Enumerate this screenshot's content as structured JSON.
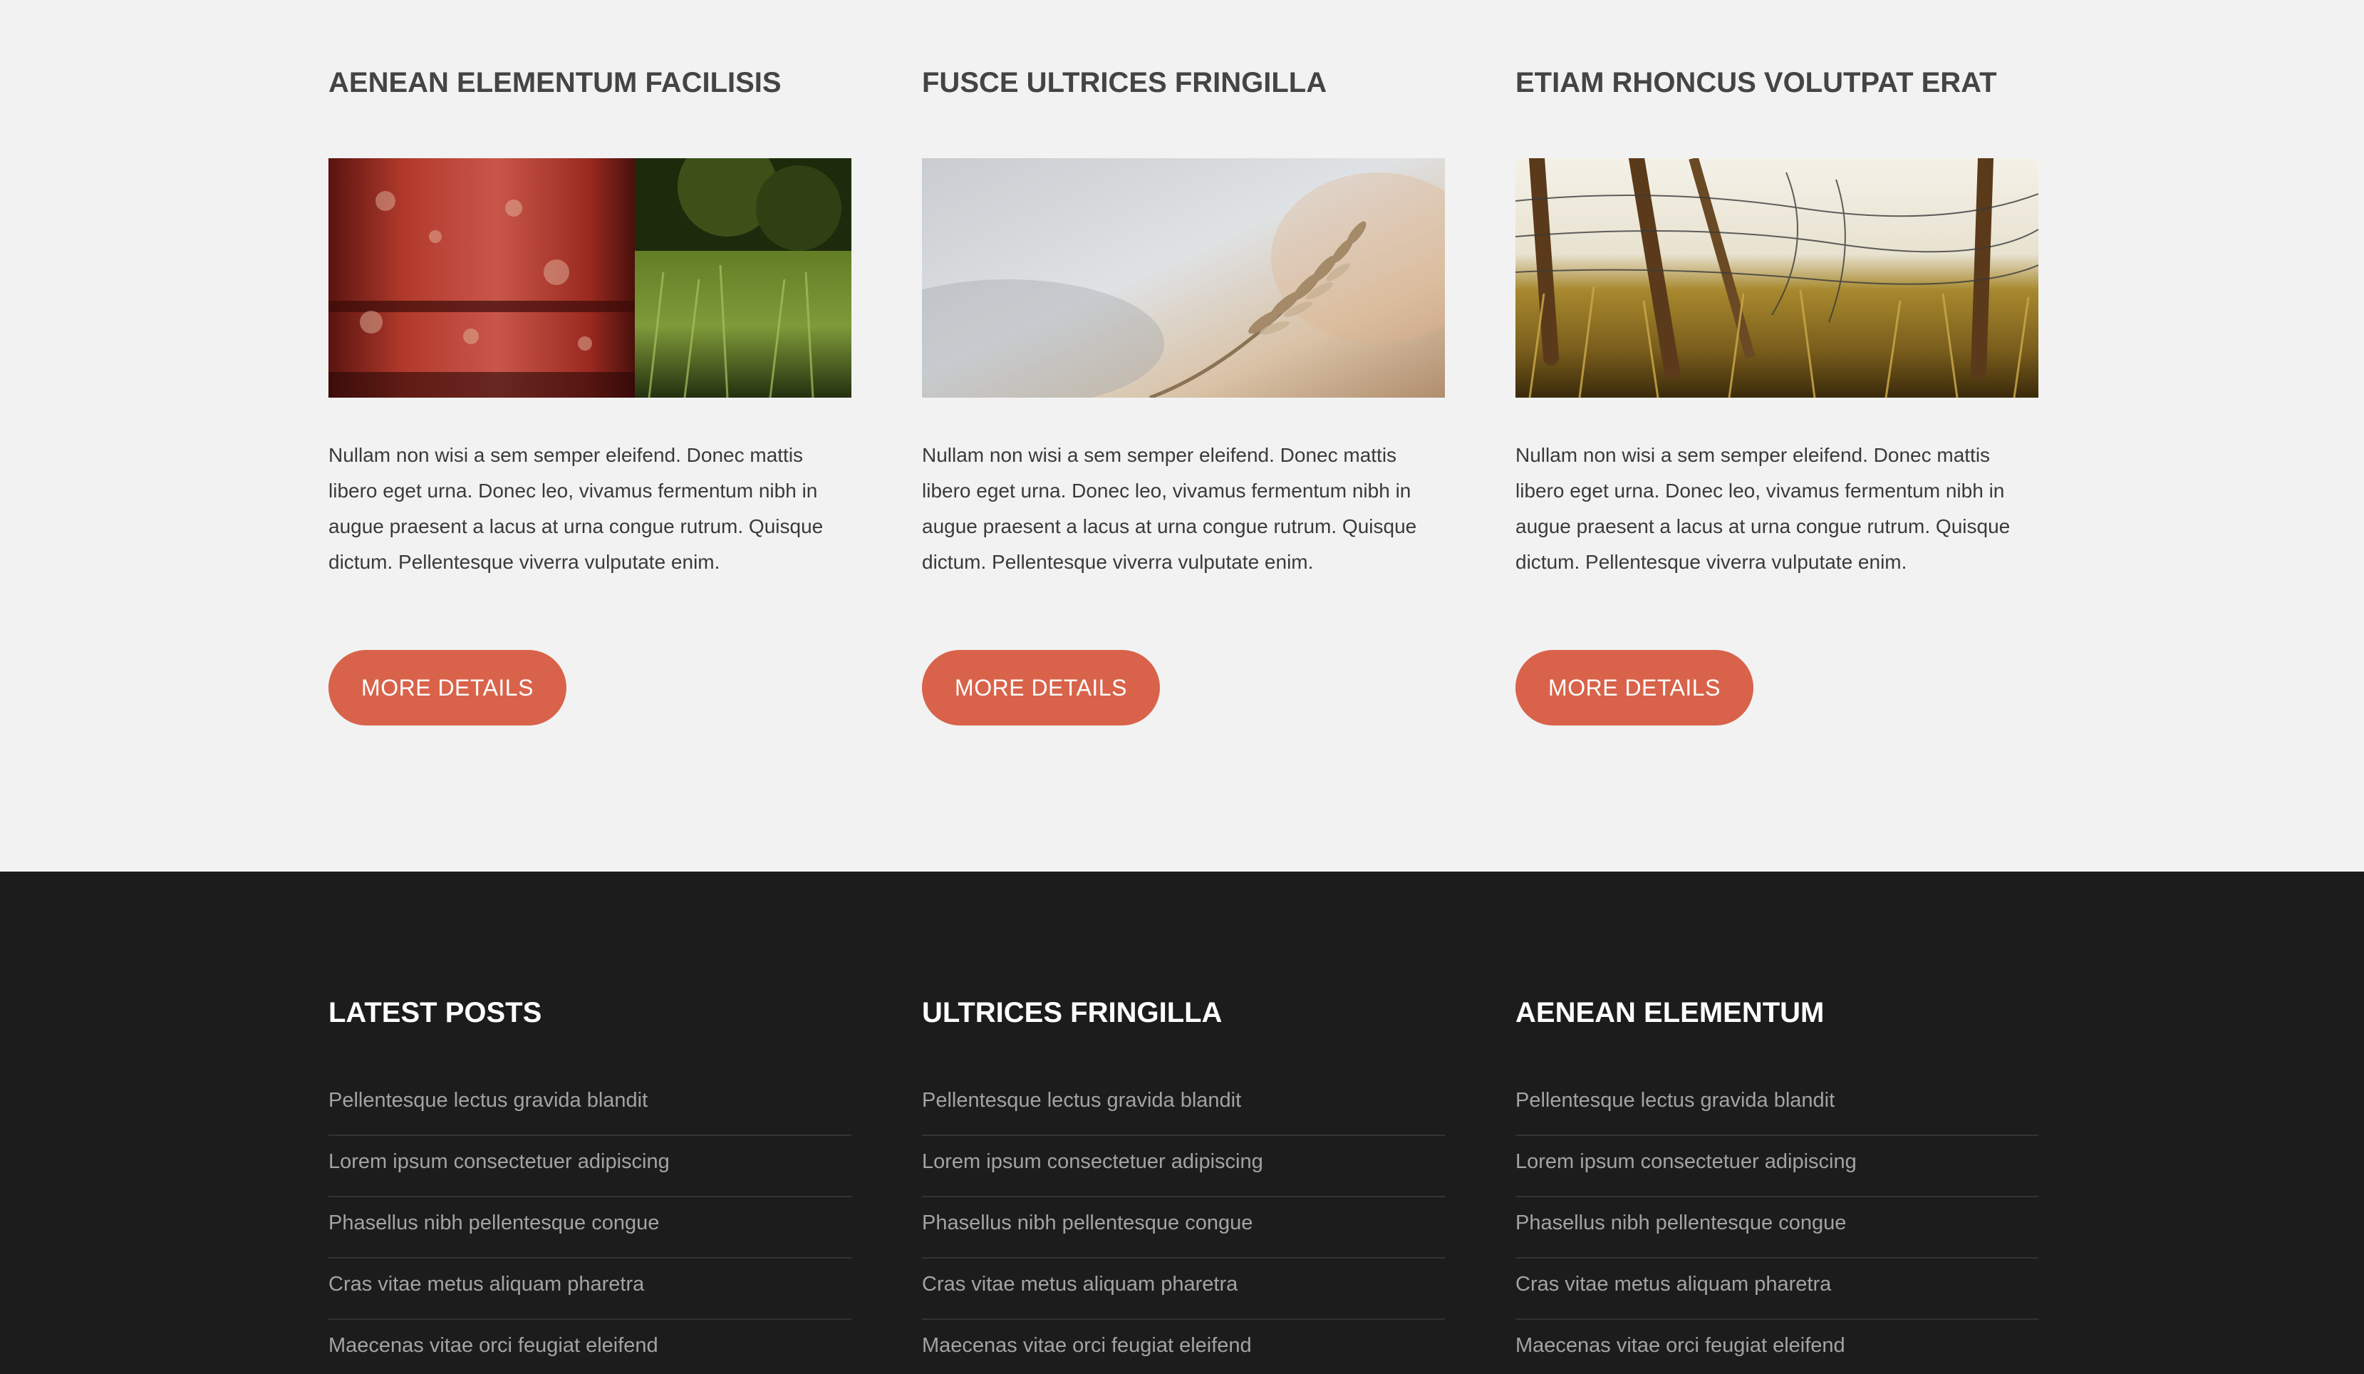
{
  "cards": [
    {
      "title": "AENEAN ELEMENTUM FACILISIS",
      "image": "rusty-barrel-in-grass",
      "text": "Nullam non wisi a sem semper eleifend. Donec mattis libero eget urna. Donec leo, vivamus fermentum nibh in augue praesent a lacus at urna congue rutrum. Quisque dictum. Pellentesque viverra vulputate enim.",
      "button": "MORE DETAILS"
    },
    {
      "title": "FUSCE ULTRICES FRINGILLA",
      "image": "wheat-stalk",
      "text": "Nullam non wisi a sem semper eleifend. Donec mattis libero eget urna. Donec leo, vivamus fermentum nibh in augue praesent a lacus at urna congue rutrum. Quisque dictum. Pellentesque viverra vulputate enim.",
      "button": "MORE DETAILS"
    },
    {
      "title": "ETIAM RHONCUS VOLUTPAT ERAT",
      "image": "fence-in-dry-grass",
      "text": "Nullam non wisi a sem semper eleifend. Donec mattis libero eget urna. Donec leo, vivamus fermentum nibh in augue praesent a lacus at urna congue rutrum. Quisque dictum. Pellentesque viverra vulputate enim.",
      "button": "MORE DETAILS"
    }
  ],
  "footer": {
    "columns": [
      {
        "title": "LATEST POSTS",
        "links": [
          "Pellentesque lectus gravida blandit",
          "Lorem ipsum consectetuer adipiscing",
          "Phasellus nibh pellentesque congue",
          "Cras vitae metus aliquam pharetra",
          "Maecenas vitae orci feugiat eleifend"
        ]
      },
      {
        "title": "ULTRICES FRINGILLA",
        "links": [
          "Pellentesque lectus gravida blandit",
          "Lorem ipsum consectetuer adipiscing",
          "Phasellus nibh pellentesque congue",
          "Cras vitae metus aliquam pharetra",
          "Maecenas vitae orci feugiat eleifend"
        ]
      },
      {
        "title": "AENEAN ELEMENTUM",
        "links": [
          "Pellentesque lectus gravida blandit",
          "Lorem ipsum consectetuer adipiscing",
          "Phasellus nibh pellentesque congue",
          "Cras vitae metus aliquam pharetra",
          "Maecenas vitae orci feugiat eleifend"
        ]
      }
    ]
  },
  "colors": {
    "accent": "#d8634a",
    "page_background": "#f2f2f2",
    "footer_background": "#1c1c1c",
    "heading_text": "#444444",
    "footer_link": "#a3a3a3"
  }
}
